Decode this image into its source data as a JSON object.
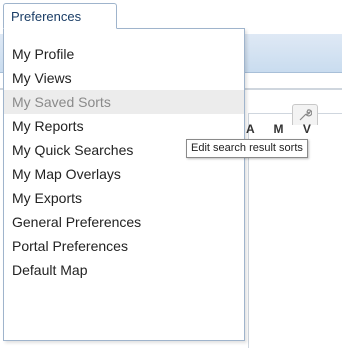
{
  "tab": {
    "label": "Preferences"
  },
  "menu": {
    "items": [
      {
        "label": "My Profile"
      },
      {
        "label": "My Views"
      },
      {
        "label": "My Saved Sorts",
        "state": "hover"
      },
      {
        "label": "My Reports"
      },
      {
        "label": "My Quick Searches"
      },
      {
        "label": "My Map Overlays"
      },
      {
        "label": "My Exports"
      },
      {
        "label": "General Preferences"
      },
      {
        "label": "Portal Preferences"
      },
      {
        "label": "Default Map"
      }
    ]
  },
  "tooltip": {
    "text": "Edit search result sorts"
  },
  "background": {
    "columns": "A M V"
  },
  "colors": {
    "menu_border": "#9fb4cc",
    "band": "#c9dcef",
    "hover_bg": "#ececec"
  }
}
